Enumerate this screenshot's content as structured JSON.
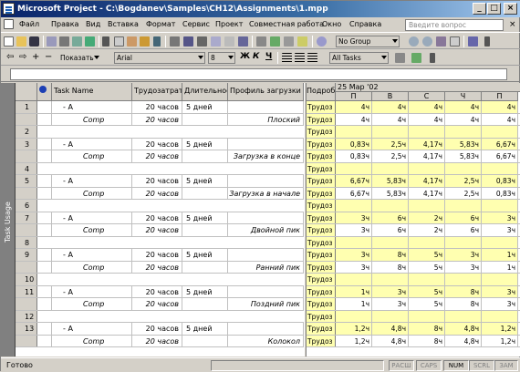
{
  "window": {
    "title": "Microsoft Project - C:\\Bogdanev\\Samples\\CH12\\Assignments\\1.mpp"
  },
  "menu": [
    "Файл",
    "Правка",
    "Вид",
    "Вставка",
    "Формат",
    "Сервис",
    "Проект",
    "Совместная работа",
    "Окно",
    "Справка"
  ],
  "help_placeholder": "Введите вопрос",
  "toolbar": {
    "group_value": "No Group",
    "show_label": "Показать",
    "font_value": "Arial",
    "size_value": "8",
    "bold": "Ж",
    "italic": "К",
    "underline": "Ч",
    "filter_value": "All Tasks"
  },
  "view_bar_label": "Task Usage",
  "table": {
    "headers": [
      "Task Name",
      "Трудозатраты",
      "Длительность",
      "Профиль загрузки",
      "Подробности"
    ],
    "rows": [
      {
        "num": "1",
        "name": "A",
        "work": "20 часов",
        "dur": "5 дней",
        "res": "Comp",
        "rwork": "20 часов",
        "profile": "Плоский",
        "bars": [
          4,
          4,
          4,
          4,
          4
        ]
      },
      {
        "num": "3",
        "name": "A",
        "work": "20 часов",
        "dur": "5 дней",
        "res": "Comp",
        "rwork": "20 часов",
        "profile": "Загрузка в конце",
        "bars": [
          1,
          3,
          5,
          6,
          7
        ]
      },
      {
        "num": "5",
        "name": "A",
        "work": "20 часов",
        "dur": "5 дней",
        "res": "Comp",
        "rwork": "20 часов",
        "profile": "Загрузка в начале",
        "bars": [
          7,
          6,
          5,
          3,
          1
        ]
      },
      {
        "num": "7",
        "name": "A",
        "work": "20 часов",
        "dur": "5 дней",
        "res": "Comp",
        "rwork": "20 часов",
        "profile": "Двойной пик",
        "bars": [
          3,
          6,
          2,
          6,
          3
        ]
      },
      {
        "num": "9",
        "name": "A",
        "work": "20 часов",
        "dur": "5 дней",
        "res": "Comp",
        "rwork": "20 часов",
        "profile": "Ранний пик",
        "bars": [
          3,
          7,
          5,
          3,
          1
        ]
      },
      {
        "num": "11",
        "name": "A",
        "work": "20 часов",
        "dur": "5 дней",
        "res": "Comp",
        "rwork": "20 часов",
        "profile": "Поздний пик",
        "bars": [
          1,
          3,
          5,
          7,
          3
        ]
      },
      {
        "num": "13",
        "name": "A",
        "work": "20 часов",
        "dur": "5 дней",
        "res": "Comp",
        "rwork": "20 часов",
        "profile": "Колокол",
        "bars": [
          1,
          4,
          7,
          4,
          1
        ]
      }
    ],
    "blank_rows": [
      "2",
      "4",
      "6",
      "8",
      "10",
      "12"
    ]
  },
  "usage": {
    "week_label": "25 Мар '02",
    "days": [
      "П",
      "В",
      "С",
      "Ч",
      "П"
    ],
    "detail_label": "Трудоз",
    "task_values": [
      [
        "4ч",
        "4ч",
        "4ч",
        "4ч",
        "4ч"
      ],
      [
        "0,83ч",
        "2,5ч",
        "4,17ч",
        "5,83ч",
        "6,67ч"
      ],
      [
        "6,67ч",
        "5,83ч",
        "4,17ч",
        "2,5ч",
        "0,83ч"
      ],
      [
        "3ч",
        "6ч",
        "2ч",
        "6ч",
        "3ч"
      ],
      [
        "3ч",
        "8ч",
        "5ч",
        "3ч",
        "1ч"
      ],
      [
        "1ч",
        "3ч",
        "5ч",
        "8ч",
        "3ч"
      ],
      [
        "1,2ч",
        "4,8ч",
        "8ч",
        "4,8ч",
        "1,2ч"
      ]
    ],
    "res_values": [
      [
        "4ч",
        "4ч",
        "4ч",
        "4ч",
        "4ч"
      ],
      [
        "0,83ч",
        "2,5ч",
        "4,17ч",
        "5,83ч",
        "6,67ч"
      ],
      [
        "6,67ч",
        "5,83ч",
        "4,17ч",
        "2,5ч",
        "0,83ч"
      ],
      [
        "3ч",
        "6ч",
        "2ч",
        "6ч",
        "3ч"
      ],
      [
        "3ч",
        "8ч",
        "5ч",
        "3ч",
        "1ч"
      ],
      [
        "1ч",
        "3ч",
        "5ч",
        "8ч",
        "3ч"
      ],
      [
        "1,2ч",
        "4,8ч",
        "8ч",
        "4,8ч",
        "1,2ч"
      ]
    ]
  },
  "status": {
    "ready": "Готово",
    "indicators": [
      "РАСШ",
      "CAPS",
      "NUM",
      "SCRL",
      "ЗАМ"
    ],
    "active": [
      "NUM"
    ]
  }
}
